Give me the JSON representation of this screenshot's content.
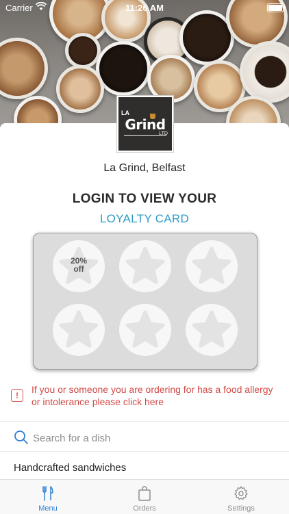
{
  "status_bar": {
    "carrier": "Carrier",
    "time": "11:26 AM"
  },
  "venue": {
    "logo_top": "LA",
    "logo_main": "Grind",
    "logo_suffix": "LTD",
    "name": "La Grind, Belfast"
  },
  "loyalty": {
    "title": "LOGIN TO VIEW YOUR",
    "link": "LOYALTY CARD",
    "reward_line1": "20%",
    "reward_line2": "off",
    "stamps_collected": 0,
    "stamps_total": 6
  },
  "allergy": {
    "text": "If you or someone you are ordering for has a food allergy or intolerance please click here",
    "color": "#d24a46"
  },
  "search": {
    "placeholder": "Search for a dish"
  },
  "categories": [
    "Handcrafted sandwiches"
  ],
  "tabs": [
    {
      "label": "Menu",
      "icon": "fork-knife-icon",
      "active": true
    },
    {
      "label": "Orders",
      "icon": "shopping-bag-icon",
      "active": false
    },
    {
      "label": "Settings",
      "icon": "gear-icon",
      "active": false
    }
  ],
  "colors": {
    "accent": "#2f7fd0",
    "link": "#2f9cc4",
    "warning": "#d9534f"
  }
}
